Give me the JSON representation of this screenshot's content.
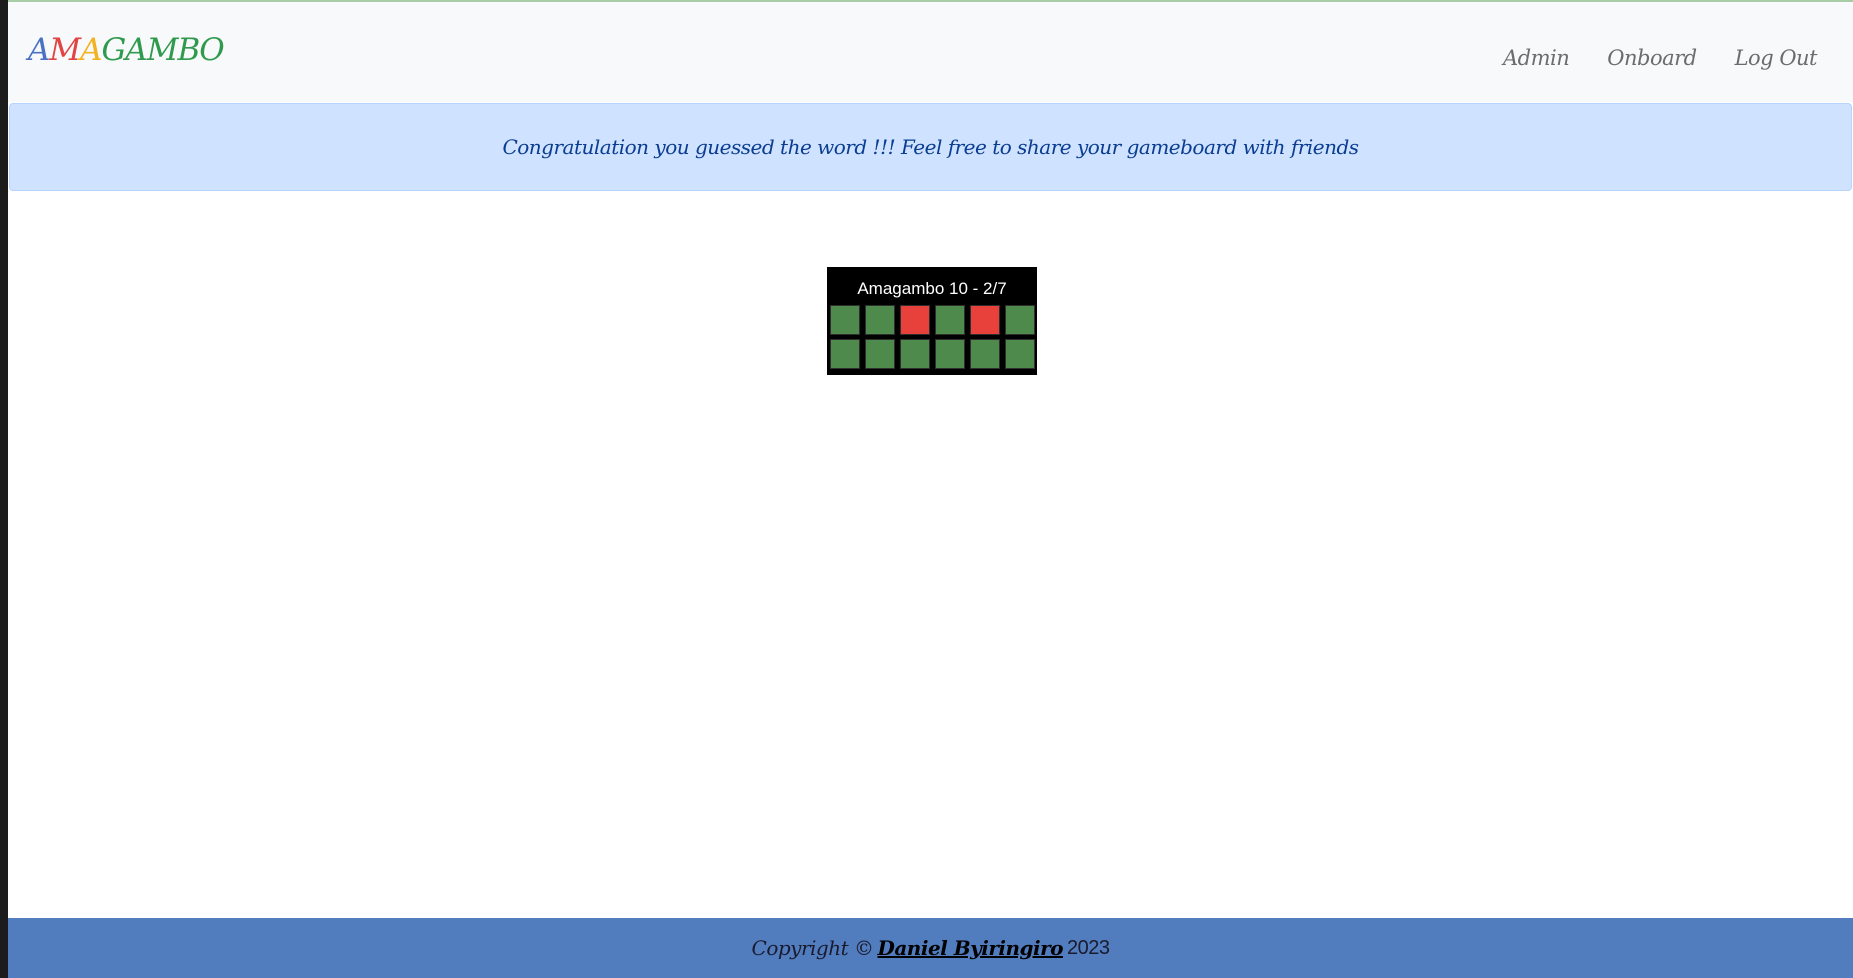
{
  "navbar": {
    "brand_letters": [
      {
        "char": "A",
        "color": "#4a72c4"
      },
      {
        "char": "M",
        "color": "#e04444"
      },
      {
        "char": "A",
        "color": "#f2b323"
      },
      {
        "char": "G",
        "color": "#2f9a4e"
      },
      {
        "char": "A",
        "color": "#2f9a4e"
      },
      {
        "char": "M",
        "color": "#2f9a4e"
      },
      {
        "char": "B",
        "color": "#2f9a4e"
      },
      {
        "char": "O",
        "color": "#2f9a4e"
      }
    ],
    "links": [
      {
        "label": "Admin"
      },
      {
        "label": "Onboard"
      },
      {
        "label": "Log Out"
      }
    ]
  },
  "alert": {
    "text": "Congratulation you guessed the word !!! Feel free to share your gameboard with friends"
  },
  "board": {
    "title": "Amagambo 10 - 2/7",
    "rows": [
      [
        "green",
        "green",
        "red",
        "green",
        "red",
        "green"
      ],
      [
        "green",
        "green",
        "green",
        "green",
        "green",
        "green"
      ]
    ],
    "colors": {
      "green": "#4e8a4b",
      "red": "#e8403a"
    }
  },
  "footer": {
    "prefix": "Copyright ©",
    "author": "Daniel Byiringiro",
    "year": "2023"
  }
}
